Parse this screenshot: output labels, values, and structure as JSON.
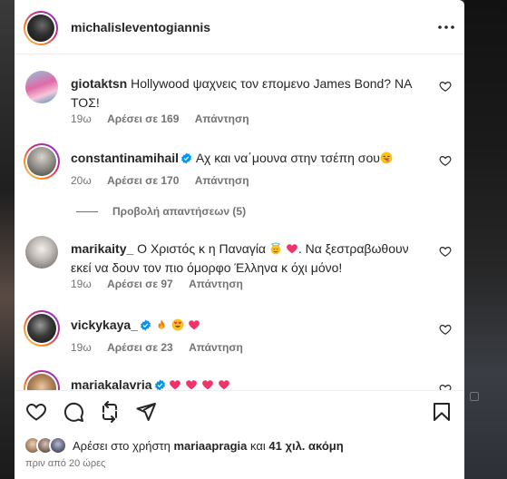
{
  "post": {
    "author": "michalisleventogiannis",
    "more_icon": "more-horizontal-icon"
  },
  "comments": [
    {
      "username": "giotaktsn",
      "verified": false,
      "text": "Hollywood ψαχνεις τον επομενο James Bond? ΝΑ ΤΟΣ!",
      "time": "19ω",
      "likes": "Αρέσει σε 169",
      "reply": "Απάντηση"
    },
    {
      "username": "constantinamihail",
      "verified": true,
      "text": "Αχ και να΄μουνα στην τσέπη σου",
      "emoji_after": "face-with-tongue-emoji",
      "time": "20ω",
      "likes": "Αρέσει σε 170",
      "reply": "Απάντηση",
      "view_replies": "Προβολή απαντήσεων (5)"
    },
    {
      "username": "marikaity_",
      "verified": false,
      "text_before": "Ο Χριστός κ η Παναγία",
      "emojis_mid": [
        "smiling-face-with-halo-emoji",
        "pink-heart-emoji"
      ],
      "text_after": ". Να ξεστραβωθουν εκεί να δουν τον πιο όμορφο Έλληνα κ όχι μόνο!",
      "time": "19ω",
      "likes": "Αρέσει σε 97",
      "reply": "Απάντηση"
    },
    {
      "username": "vickykaya_",
      "verified": true,
      "emojis": [
        "fire-emoji",
        "smiling-face-with-heart-eyes-emoji",
        "pink-heart-emoji"
      ],
      "time": "19ω",
      "likes": "Αρέσει σε 23",
      "reply": "Απάντηση"
    },
    {
      "username": "mariakalavria",
      "verified": true,
      "emojis": [
        "pink-heart-emoji",
        "pink-heart-emoji",
        "pink-heart-emoji",
        "pink-heart-emoji"
      ]
    }
  ],
  "actions": {
    "like_icon": "heart-icon",
    "comment_icon": "comment-icon",
    "repost_icon": "repost-icon",
    "share_icon": "send-icon",
    "save_icon": "bookmark-icon"
  },
  "likes": {
    "prefix": "Αρέσει στο χρήστη",
    "user": "mariaapragia",
    "connector": "και",
    "others": "41 χιλ. ακόμη"
  },
  "timestamp": "πριν από 20 ώρες",
  "colors": {
    "text": "#262626",
    "secondary": "#737373",
    "verified": "#0095f6",
    "heart_emoji": "#f0346a",
    "divider": "#efefef"
  }
}
